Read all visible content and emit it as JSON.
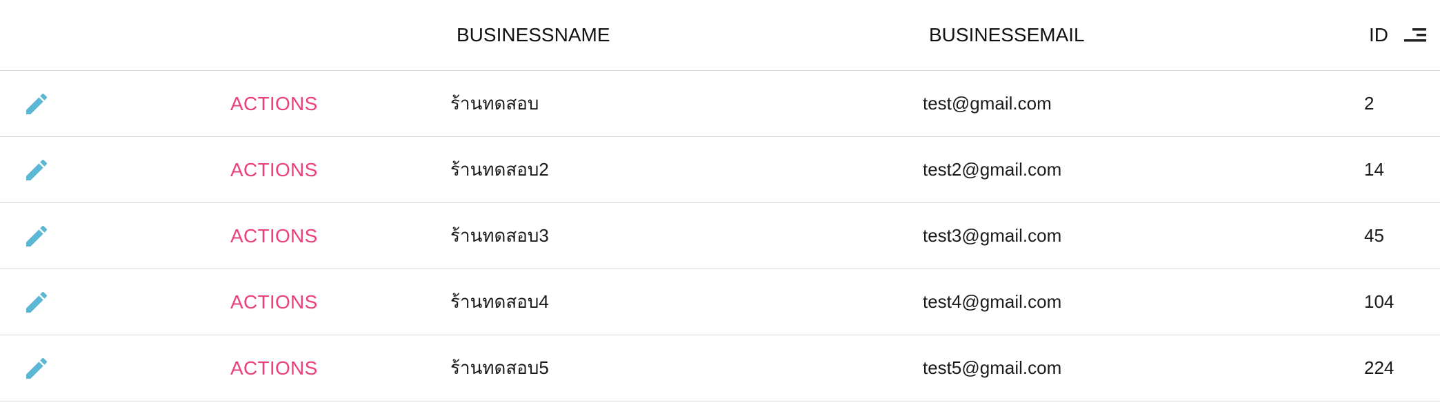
{
  "colors": {
    "accent_actions": "#ec407a",
    "edit_icon": "#5bb8d4",
    "divider": "#d6d6d6"
  },
  "table": {
    "columns": {
      "business_name": "BUSINESSNAME",
      "business_email": "BUSINESSEMAIL",
      "id": "ID"
    },
    "sort_icon": "sort-lines-icon",
    "edit_icon": "pencil-icon",
    "rows": [
      {
        "action_label": "ACTIONS",
        "business_name": "ร้านทดสอบ",
        "business_email": "test@gmail.com",
        "id": "2"
      },
      {
        "action_label": "ACTIONS",
        "business_name": "ร้านทดสอบ2",
        "business_email": "test2@gmail.com",
        "id": "14"
      },
      {
        "action_label": "ACTIONS",
        "business_name": "ร้านทดสอบ3",
        "business_email": "test3@gmail.com",
        "id": "45"
      },
      {
        "action_label": "ACTIONS",
        "business_name": "ร้านทดสอบ4",
        "business_email": "test4@gmail.com",
        "id": "104"
      },
      {
        "action_label": "ACTIONS",
        "business_name": "ร้านทดสอบ5",
        "business_email": "test5@gmail.com",
        "id": "224"
      }
    ]
  }
}
